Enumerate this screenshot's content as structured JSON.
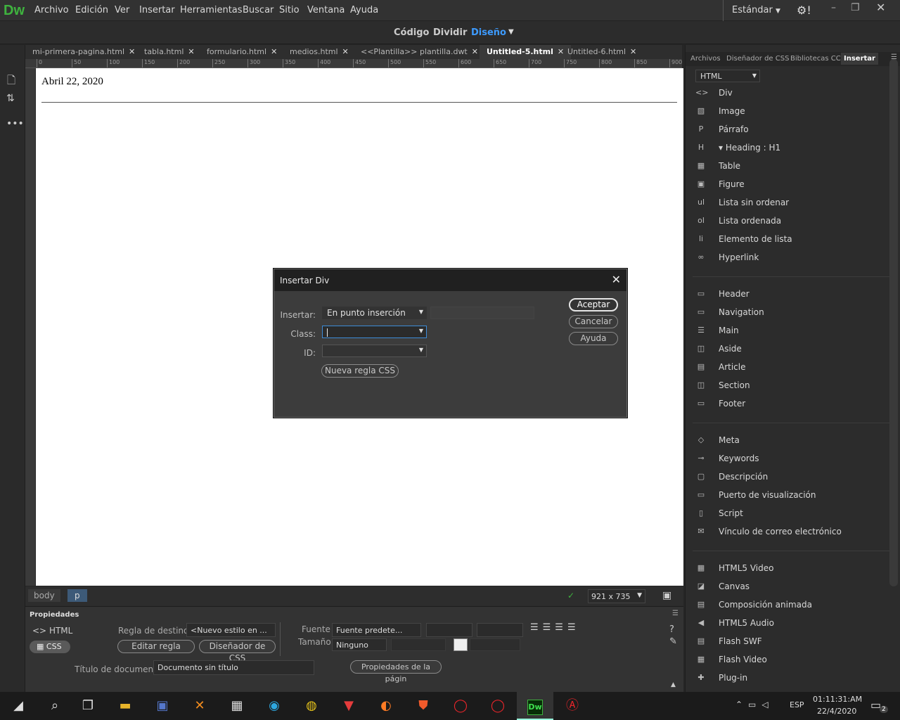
{
  "app": {
    "logo": "Dw",
    "menu": [
      "Archivo",
      "Edición",
      "Ver",
      "Insertar",
      "Herramientas",
      "Buscar",
      "Sitio",
      "Ventana",
      "Ayuda"
    ],
    "workspace": "Estándar"
  },
  "view": {
    "codigo": "Código",
    "dividir": "Dividir",
    "diseno": "Diseño"
  },
  "tabs": [
    "mi-primera-pagina.html",
    "tabla.html",
    "formulario.html",
    "medios.html",
    "<<Plantilla>> plantilla.dwt",
    "Untitled-5.html",
    "Untitled-6.html"
  ],
  "ruler": [
    "0",
    "50",
    "100",
    "150",
    "200",
    "250",
    "300",
    "350",
    "400",
    "450",
    "500",
    "550",
    "600",
    "650",
    "700",
    "750",
    "800",
    "850",
    "900"
  ],
  "doc": {
    "date": "Abril 22, 2020"
  },
  "status": {
    "tag1": "body",
    "tag2": "p",
    "size": "921 x 735"
  },
  "props": {
    "title": "Propiedades",
    "html": "HTML",
    "css": "CSS",
    "regla_label": "Regla de destino",
    "regla_value": "<Nuevo estilo en ...",
    "editar": "Editar regla",
    "disenador": "Diseñador de CSS",
    "fuente_label": "Fuente",
    "fuente_value": "Fuente predete...",
    "tamano_label": "Tamaño",
    "tamano_value": "Ninguno",
    "titulo_label": "Título de documento",
    "titulo_value": "Documento sin título",
    "propiedades": "Propiedades de la págin"
  },
  "panel": {
    "tabs": [
      "Archivos",
      "Diseñador de CSS",
      "Bibliotecas CC",
      "Insertar"
    ],
    "category": "HTML",
    "group1": [
      {
        "icon": "div-icon",
        "glyph": "<>",
        "label": "Div"
      },
      {
        "icon": "image-icon",
        "glyph": "▧",
        "label": "Image"
      },
      {
        "icon": "paragraph-icon",
        "glyph": "P",
        "label": "Párrafo"
      },
      {
        "icon": "heading-icon",
        "glyph": "H",
        "label": "▾ Heading : H1"
      },
      {
        "icon": "table-icon",
        "glyph": "▦",
        "label": "Table"
      },
      {
        "icon": "figure-icon",
        "glyph": "▣",
        "label": "Figure"
      },
      {
        "icon": "ul-icon",
        "glyph": "ul",
        "label": "Lista sin ordenar"
      },
      {
        "icon": "ol-icon",
        "glyph": "ol",
        "label": "Lista ordenada"
      },
      {
        "icon": "li-icon",
        "glyph": "li",
        "label": "Elemento de lista"
      },
      {
        "icon": "hyperlink-icon",
        "glyph": "∞",
        "label": "Hyperlink"
      }
    ],
    "group2": [
      {
        "icon": "header-icon",
        "glyph": "▭",
        "label": "Header"
      },
      {
        "icon": "navigation-icon",
        "glyph": "▭",
        "label": "Navigation"
      },
      {
        "icon": "main-icon",
        "glyph": "☰",
        "label": "Main"
      },
      {
        "icon": "aside-icon",
        "glyph": "◫",
        "label": "Aside"
      },
      {
        "icon": "article-icon",
        "glyph": "▤",
        "label": "Article"
      },
      {
        "icon": "section-icon",
        "glyph": "◫",
        "label": "Section"
      },
      {
        "icon": "footer-icon",
        "glyph": "▭",
        "label": "Footer"
      }
    ],
    "group3": [
      {
        "icon": "meta-icon",
        "glyph": "◇",
        "label": "Meta"
      },
      {
        "icon": "keywords-icon",
        "glyph": "⊸",
        "label": "Keywords"
      },
      {
        "icon": "description-icon",
        "glyph": "▢",
        "label": "Descripción"
      },
      {
        "icon": "viewport-icon",
        "glyph": "▭",
        "label": "Puerto de visualización"
      },
      {
        "icon": "script-icon",
        "glyph": "▯",
        "label": "Script"
      },
      {
        "icon": "email-icon",
        "glyph": "✉",
        "label": "Vínculo de correo electrónico"
      }
    ],
    "group4": [
      {
        "icon": "video-icon",
        "glyph": "▦",
        "label": "HTML5 Video"
      },
      {
        "icon": "canvas-icon",
        "glyph": "◪",
        "label": "Canvas"
      },
      {
        "icon": "animation-icon",
        "glyph": "▤",
        "label": "Composición animada"
      },
      {
        "icon": "audio-icon",
        "glyph": "◀",
        "label": "HTML5 Audio"
      },
      {
        "icon": "swf-icon",
        "glyph": "▤",
        "label": "Flash SWF"
      },
      {
        "icon": "flashvideo-icon",
        "glyph": "▦",
        "label": "Flash Video"
      },
      {
        "icon": "plugin-icon",
        "glyph": "✚",
        "label": "Plug-in"
      }
    ]
  },
  "dialog": {
    "title": "Insertar Div",
    "insertar_label": "Insertar:",
    "insertar_value": "En punto inserción",
    "class_label": "Class:",
    "class_value": "",
    "id_label": "ID:",
    "id_value": "",
    "nueva": "Nueva regla CSS",
    "aceptar": "Aceptar",
    "cancelar": "Cancelar",
    "ayuda": "Ayuda"
  },
  "taskbar": {
    "lang": "ESP",
    "time": "01:11:31:AM",
    "date": "22/4/2020",
    "notif": "2"
  }
}
